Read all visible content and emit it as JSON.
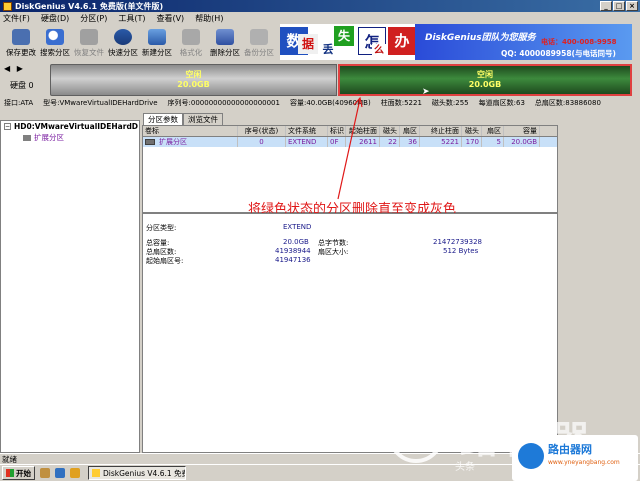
{
  "window": {
    "title": "DiskGenius V4.6.1 免费版(单文件版)",
    "buttons": [
      "_",
      "□",
      "×"
    ]
  },
  "menu": [
    "文件(F)",
    "硬盘(D)",
    "分区(P)",
    "工具(T)",
    "查看(V)",
    "帮助(H)"
  ],
  "toolbar": [
    {
      "label": "保存更改",
      "enabled": true
    },
    {
      "label": "搜索分区",
      "enabled": true
    },
    {
      "label": "恢复文件",
      "enabled": false
    },
    {
      "label": "快速分区",
      "enabled": true
    },
    {
      "label": "新建分区",
      "enabled": true
    },
    {
      "label": "格式化",
      "enabled": false
    },
    {
      "label": "删除分区",
      "enabled": true
    },
    {
      "label": "备份分区",
      "enabled": false
    }
  ],
  "banner": {
    "tiles": [
      "数",
      "据",
      "丢",
      "失",
      "怎",
      "么",
      "办"
    ],
    "team": "DiskGenius团队为您服务",
    "tel": "电话：400-008-9958",
    "qq": "QQ: 4000089958(与电话同号)"
  },
  "diskmap": {
    "disk_label": "硬盘 0",
    "left": {
      "name": "空闲",
      "size": "20.0GB"
    },
    "right": {
      "name": "空闲",
      "size": "20.0GB"
    }
  },
  "diskinfo": {
    "interface": "接口:ATA",
    "model": "型号:VMwareVirtualIDEHardDrive",
    "serial": "序列号:00000000000000000001",
    "capacity": "容量:40.0GB(40960MB)",
    "cylinders": "柱面数:5221",
    "heads": "磁头数:255",
    "sectors_per_track": "每道扇区数:63",
    "total_sectors": "总扇区数:83886080"
  },
  "tree": {
    "root": "HD0:VMwareVirtualIDEHardD",
    "child": "扩展分区"
  },
  "tabs": [
    "分区参数",
    "浏览文件"
  ],
  "table": {
    "headers": [
      "卷标",
      "序号(状态)",
      "文件系统",
      "标识",
      "起始柱面",
      "磁头",
      "扇区",
      "终止柱面",
      "磁头",
      "扇区",
      "容量"
    ],
    "rows": [
      {
        "name": "扩展分区",
        "seq": "0",
        "fs": "EXTEND",
        "id": "0F",
        "start_cyl": "2611",
        "start_head": "22",
        "start_sec": "36",
        "end_cyl": "5221",
        "end_head": "170",
        "end_sec": "5",
        "capacity": "20.0GB"
      }
    ]
  },
  "details": {
    "type_label": "分区类型:",
    "type_value": "EXTEND",
    "total_cap_label": "总容量:",
    "total_cap_value": "20.0GB",
    "total_bytes_label": "总字节数:",
    "total_bytes_value": "21472739328",
    "total_sectors_label": "总扇区数:",
    "total_sectors_value": "41938944",
    "sector_size_label": "扇区大小:",
    "sector_size_value": "512 Bytes",
    "start_sector_label": "起始扇区号:",
    "start_sector_value": "41947136"
  },
  "annotation": "将绿色状态的分区删除直至变成灰色",
  "status": "就绪",
  "taskbar": {
    "start": "开始",
    "task": "DiskGenius V4.6.1 免费..."
  },
  "watermark": {
    "big": "路由器",
    "small": "头条",
    "brand": "路由器网",
    "url": "www.yneyangbang.com"
  },
  "colors": {
    "free_gray": "#b0b0b0",
    "green_partition": "#2f7a2f",
    "annotation_red": "#e01818"
  }
}
